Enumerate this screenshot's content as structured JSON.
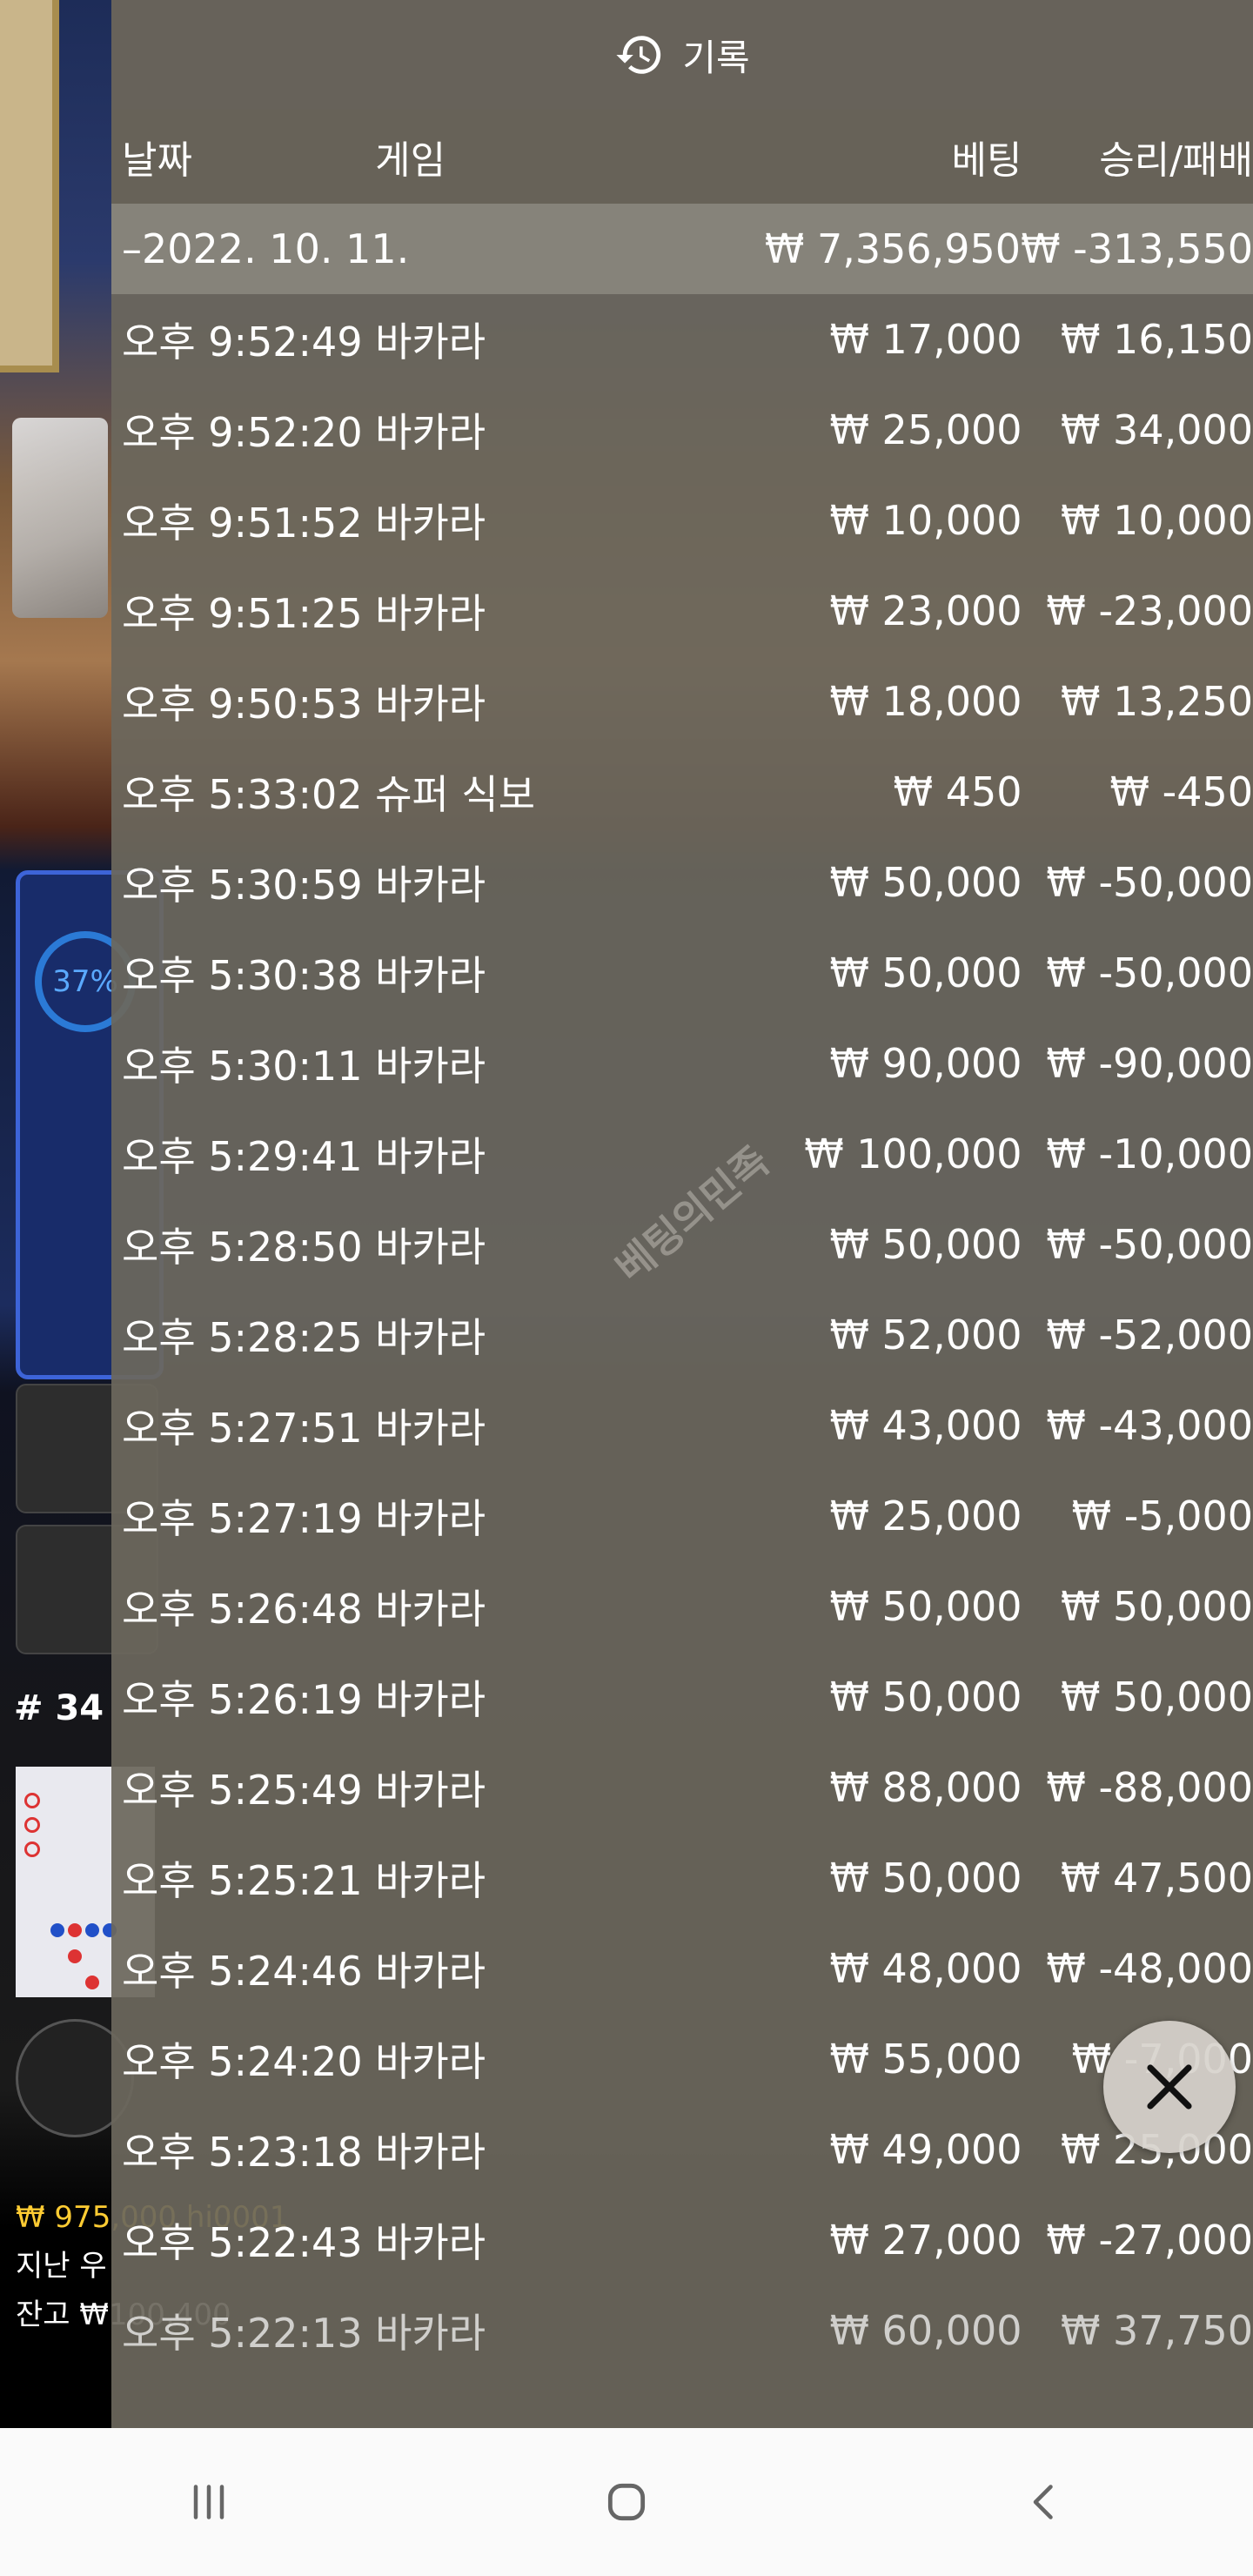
{
  "window": {
    "title": "기록"
  },
  "columns": {
    "date": "날짜",
    "game": "게임",
    "bet": "베팅",
    "win_loss": "승리/패배"
  },
  "summary": {
    "date": "–2022. 10. 11.",
    "bet": "₩ 7,356,950",
    "win_loss": "₩ -313,550"
  },
  "rows": [
    {
      "time": "오후 9:52:49",
      "game": "바카라",
      "bet": "₩ 17,000",
      "win_loss": "₩ 16,150"
    },
    {
      "time": "오후 9:52:20",
      "game": "바카라",
      "bet": "₩ 25,000",
      "win_loss": "₩ 34,000"
    },
    {
      "time": "오후 9:51:52",
      "game": "바카라",
      "bet": "₩ 10,000",
      "win_loss": "₩ 10,000"
    },
    {
      "time": "오후 9:51:25",
      "game": "바카라",
      "bet": "₩ 23,000",
      "win_loss": "₩ -23,000"
    },
    {
      "time": "오후 9:50:53",
      "game": "바카라",
      "bet": "₩ 18,000",
      "win_loss": "₩ 13,250"
    },
    {
      "time": "오후 5:33:02",
      "game": "슈퍼 식보",
      "bet": "₩ 450",
      "win_loss": "₩ -450"
    },
    {
      "time": "오후 5:30:59",
      "game": "바카라",
      "bet": "₩ 50,000",
      "win_loss": "₩ -50,000"
    },
    {
      "time": "오후 5:30:38",
      "game": "바카라",
      "bet": "₩ 50,000",
      "win_loss": "₩ -50,000"
    },
    {
      "time": "오후 5:30:11",
      "game": "바카라",
      "bet": "₩ 90,000",
      "win_loss": "₩ -90,000"
    },
    {
      "time": "오후 5:29:41",
      "game": "바카라",
      "bet": "₩ 100,000",
      "win_loss": "₩ -10,000"
    },
    {
      "time": "오후 5:28:50",
      "game": "바카라",
      "bet": "₩ 50,000",
      "win_loss": "₩ -50,000"
    },
    {
      "time": "오후 5:28:25",
      "game": "바카라",
      "bet": "₩ 52,000",
      "win_loss": "₩ -52,000"
    },
    {
      "time": "오후 5:27:51",
      "game": "바카라",
      "bet": "₩ 43,000",
      "win_loss": "₩ -43,000"
    },
    {
      "time": "오후 5:27:19",
      "game": "바카라",
      "bet": "₩ 25,000",
      "win_loss": "₩ -5,000"
    },
    {
      "time": "오후 5:26:48",
      "game": "바카라",
      "bet": "₩ 50,000",
      "win_loss": "₩ 50,000"
    },
    {
      "time": "오후 5:26:19",
      "game": "바카라",
      "bet": "₩ 50,000",
      "win_loss": "₩ 50,000"
    },
    {
      "time": "오후 5:25:49",
      "game": "바카라",
      "bet": "₩ 88,000",
      "win_loss": "₩ -88,000"
    },
    {
      "time": "오후 5:25:21",
      "game": "바카라",
      "bet": "₩ 50,000",
      "win_loss": "₩ 47,500"
    },
    {
      "time": "오후 5:24:46",
      "game": "바카라",
      "bet": "₩ 48,000",
      "win_loss": "₩ -48,000"
    },
    {
      "time": "오후 5:24:20",
      "game": "바카라",
      "bet": "₩ 55,000",
      "win_loss": "₩ -7,000"
    },
    {
      "time": "오후 5:23:18",
      "game": "바카라",
      "bet": "₩ 49,000",
      "win_loss": "₩ 25,000"
    },
    {
      "time": "오후 5:22:43",
      "game": "바카라",
      "bet": "₩ 27,000",
      "win_loss": "₩ -27,000"
    },
    {
      "time": "오후 5:22:13",
      "game": "바카라",
      "bet": "₩ 60,000",
      "win_loss": "₩ 37,750"
    }
  ],
  "watermark": "베팅의민족",
  "background": {
    "percent": "37%",
    "round": "# 34",
    "info_line1": "₩ 975,000 hi0001",
    "info_line2": "지난 우",
    "info_line3": "잔고 ₩100,400"
  },
  "icons": {
    "title_icon": "history-icon",
    "close": "close-icon"
  },
  "colors": {
    "panel": "#6c675d",
    "titlebar": "#67625a",
    "accent_gold": "#ffcc33"
  }
}
